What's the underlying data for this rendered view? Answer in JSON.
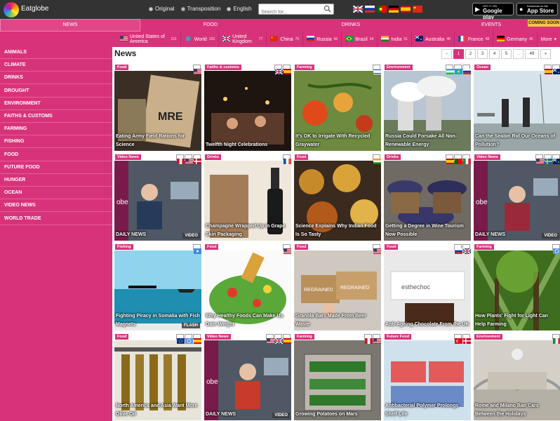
{
  "header": {
    "logo_text": "Eatglobe",
    "radios": [
      {
        "label": "Original",
        "checked": false
      },
      {
        "label": "Transposition",
        "checked": true
      },
      {
        "label": "English",
        "checked": false
      }
    ],
    "search_placeholder": "Search for...",
    "store_google": {
      "small": "GET IT ON",
      "big": "Google play"
    },
    "store_apple": {
      "small": "Download on the",
      "big": "App Store"
    }
  },
  "nav": {
    "tabs": [
      "NEWS",
      "FOOD",
      "DRINKS",
      "EVENTS"
    ],
    "coming_soon": "COMING SOON"
  },
  "countries": [
    {
      "name": "United States of America",
      "count": "211"
    },
    {
      "name": "World",
      "count": "103"
    },
    {
      "name": "United Kingdom",
      "count": "77"
    },
    {
      "name": "China",
      "count": "75"
    },
    {
      "name": "Russia",
      "count": "66"
    },
    {
      "name": "Brazil",
      "count": "64"
    },
    {
      "name": "India",
      "count": "51"
    },
    {
      "name": "Australia",
      "count": "48"
    },
    {
      "name": "France",
      "count": "48"
    },
    {
      "name": "Germany",
      "count": "45"
    }
  ],
  "countries_more": "More",
  "sidebar": [
    "ANIMALS",
    "CLIMATE",
    "DRINKS",
    "DROUGHT",
    "ENVIRONMENT",
    "FAITHS & CUSTOMS",
    "FARMING",
    "FISHING",
    "FOOD",
    "FUTURE FOOD",
    "HUNGER",
    "OCEAN",
    "VIDEO NEWS",
    "WORLD TRADE"
  ],
  "main": {
    "title": "News",
    "pagination": [
      "«",
      "1",
      "2",
      "3",
      "4",
      "5",
      "...",
      "49",
      "»"
    ],
    "active_page": "1"
  },
  "tiles": [
    {
      "tag": "Food",
      "caption": "Eating Army Field Rations for Science",
      "badge": "",
      "img_label": "MRE",
      "flags": [
        "us"
      ]
    },
    {
      "tag": "Faiths & customs",
      "caption": "Twelfth Night Celebrations",
      "badge": "",
      "img_label": "",
      "flags": [
        "gb",
        "es"
      ]
    },
    {
      "tag": "Farming",
      "caption": "It's OK to Irrigate With Recycled Graywater",
      "badge": "",
      "img_label": "",
      "flags": [
        "il"
      ]
    },
    {
      "tag": "Environment",
      "caption": "Russia Could Forsake All Non-Renewable Energy",
      "badge": "",
      "img_label": "",
      "flags": [
        "uz",
        "kz",
        "ru"
      ]
    },
    {
      "tag": "Ocean",
      "caption": "Can the Seabin Rid Our Oceans of Pollution?",
      "badge": "",
      "img_label": "",
      "flags": [
        "es",
        "au"
      ]
    },
    {
      "tag": "Video News",
      "caption": "DAILY NEWS",
      "badge": "VIDEO",
      "img_label": "obe",
      "flags": [
        "pe",
        "us",
        "dk"
      ]
    },
    {
      "tag": "Drinks",
      "caption": "Champagne Wrapped Up in Grape Skin Packaging",
      "badge": "",
      "img_label": "",
      "flags": [
        "fr"
      ]
    },
    {
      "tag": "Food",
      "caption": "Science Explains Why Indian Food Is So Tasty",
      "badge": "",
      "img_label": "",
      "flags": [
        "in"
      ]
    },
    {
      "tag": "Drinks",
      "caption": "Getting a Degree in Wine Tourism Now Possible",
      "badge": "",
      "img_label": "",
      "flags": [
        "es",
        "pt",
        "it"
      ]
    },
    {
      "tag": "Video News",
      "caption": "DAILY NEWS",
      "badge": "VIDEO",
      "img_label": "obe",
      "flags": [
        "us",
        "se",
        "au"
      ]
    },
    {
      "tag": "Fishing",
      "caption": "Fighting Piracy in Somalia with Fish Magnets",
      "badge": "FLASH",
      "img_label": "",
      "flags": [
        "so"
      ]
    },
    {
      "tag": "Food",
      "caption": "Why Healthy Foods Can Make Us Gain Weight",
      "badge": "",
      "img_label": "",
      "flags": [
        "us"
      ]
    },
    {
      "tag": "Food",
      "caption": "Granola Bars Made From Beer Waste",
      "badge": "",
      "img_label": "REGRAINED",
      "flags": [
        "us"
      ]
    },
    {
      "tag": "Food",
      "caption": "Anti-Ageing Chocolate From the UK",
      "badge": "",
      "img_label": "esthechoc",
      "flags": [
        "ru",
        "gb"
      ]
    },
    {
      "tag": "Farming",
      "caption": "How Plants' Fight for Light Can Help Farming",
      "badge": "",
      "img_label": "",
      "flags": [
        "un"
      ]
    },
    {
      "tag": "Food",
      "caption": "North America and Asia Want More Olive Oil",
      "badge": "",
      "img_label": "",
      "flags": [
        "eu",
        "un",
        "es"
      ]
    },
    {
      "tag": "Video News",
      "caption": "DAILY NEWS",
      "badge": "VIDEO",
      "img_label": "obe",
      "flags": [
        "us",
        "gb",
        "es"
      ]
    },
    {
      "tag": "Farming",
      "caption": "Growing Potatoes on Mars",
      "badge": "",
      "img_label": "",
      "flags": [
        "pe",
        "us"
      ]
    },
    {
      "tag": "Future Food",
      "caption": "Antibacterial Polymer Prolongs Shelf Life",
      "badge": "",
      "img_label": "",
      "flags": [
        "tr",
        "dk"
      ]
    },
    {
      "tag": "Environment",
      "caption": "Rome and Milano Ban Cars Between the Holidays",
      "badge": "",
      "img_label": "",
      "flags": [
        "it"
      ]
    }
  ]
}
